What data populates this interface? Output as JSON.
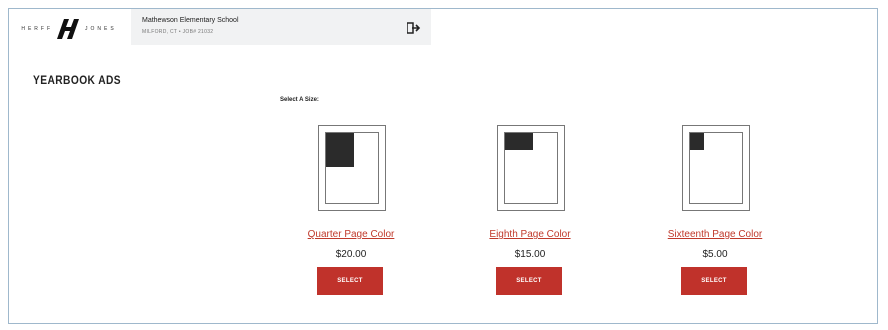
{
  "brand": {
    "left_text": "HERFF",
    "right_text": "JONES"
  },
  "school": {
    "name": "Mathewson Elementary School",
    "meta": "MILFORD, CT • JOB# 21032"
  },
  "icons": {
    "signout": "sign-out-icon"
  },
  "page": {
    "title": "YEARBOOK ADS",
    "select_label": "Select A Size:"
  },
  "options": [
    {
      "name": "Quarter Page Color",
      "price": "$20.00",
      "button": "SELECT",
      "ad_size": "quarter"
    },
    {
      "name": "Eighth Page Color",
      "price": "$15.00",
      "button": "SELECT",
      "ad_size": "eighth"
    },
    {
      "name": "Sixteenth Page Color",
      "price": "$5.00",
      "button": "SELECT",
      "ad_size": "sixteenth"
    }
  ],
  "colors": {
    "accent": "#c0322b",
    "link": "#c0392b",
    "frame_border": "#9fb8cc",
    "ad_fill": "#2b2b2b"
  }
}
